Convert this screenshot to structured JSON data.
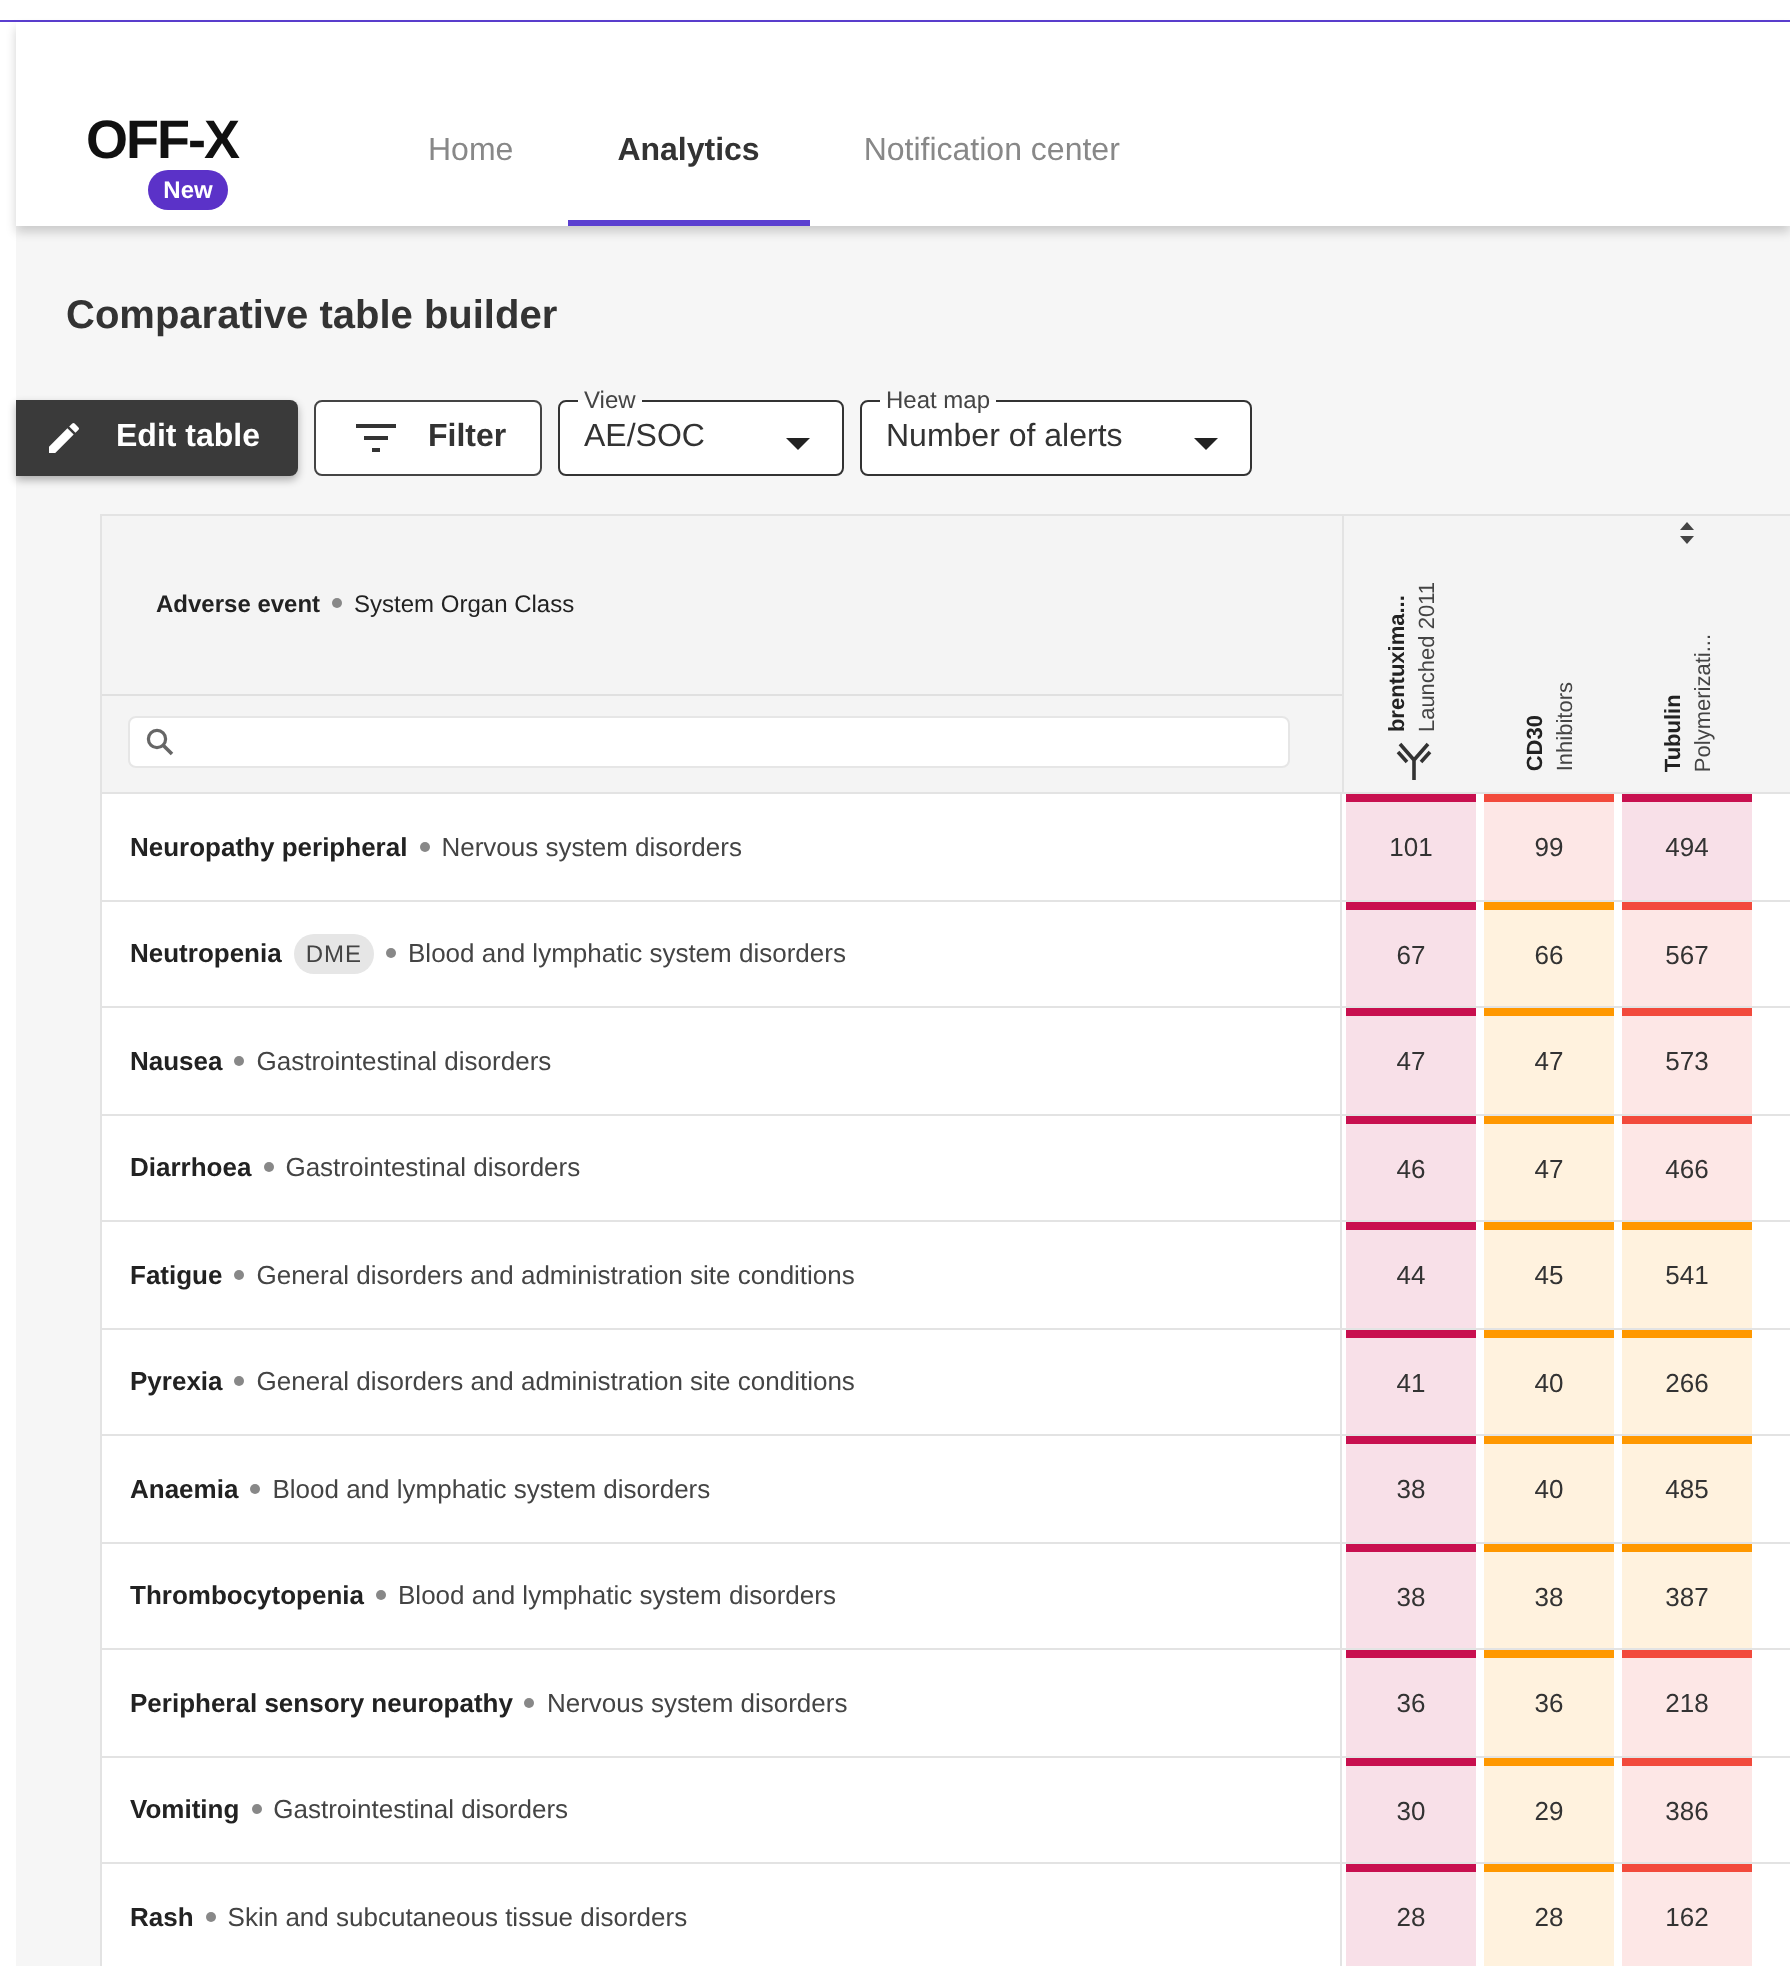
{
  "top_nav": {
    "logo": "OFF-X",
    "logo_badge": "New",
    "tabs": [
      {
        "label": "Home",
        "selected": false
      },
      {
        "label": "Analytics",
        "selected": true
      },
      {
        "label": "Notification center",
        "selected": false
      }
    ]
  },
  "page_title": "Comparative table builder",
  "toolbar": {
    "edit_button": "Edit table",
    "filter_button": "Filter",
    "view": {
      "label": "View",
      "value": "AE/SOC"
    },
    "heat_map": {
      "label": "Heat map",
      "value": "Number of alerts"
    }
  },
  "table": {
    "header": {
      "name_label": "Adverse event",
      "class_label": "System Organ Class"
    },
    "columns": [
      {
        "name": "brentuxima...",
        "sub": "Launched 2011",
        "kind": "drug",
        "sortable": false
      },
      {
        "name": "CD30",
        "sub": "Inhibitors",
        "kind": "class",
        "sortable": false
      },
      {
        "name": "Tubulin",
        "sub": "Polymerizati...",
        "kind": "class",
        "sortable": true
      }
    ],
    "rows": [
      {
        "event": "Neuropathy peripheral",
        "soc": "Nervous system disorders",
        "cells": [
          {
            "value": "101",
            "color": "#c8104f"
          },
          {
            "value": "99",
            "color": "#f24a3c"
          },
          {
            "value": "494",
            "color": "#c8104f"
          }
        ]
      },
      {
        "event": "Neutropenia",
        "tag": "DME",
        "soc": "Blood and lymphatic system disorders",
        "cells": [
          {
            "value": "67",
            "color": "#c8104f"
          },
          {
            "value": "66",
            "color": "#ff9800"
          },
          {
            "value": "567",
            "color": "#f24a3c"
          }
        ]
      },
      {
        "event": "Nausea",
        "soc": "Gastrointestinal disorders",
        "cells": [
          {
            "value": "47",
            "color": "#c8104f"
          },
          {
            "value": "47",
            "color": "#ff9800"
          },
          {
            "value": "573",
            "color": "#f24a3c"
          }
        ]
      },
      {
        "event": "Diarrhoea",
        "soc": "Gastrointestinal disorders",
        "cells": [
          {
            "value": "46",
            "color": "#c8104f"
          },
          {
            "value": "47",
            "color": "#ff9800"
          },
          {
            "value": "466",
            "color": "#f24a3c"
          }
        ]
      },
      {
        "event": "Fatigue",
        "soc": "General disorders and administration site conditions",
        "cells": [
          {
            "value": "44",
            "color": "#c8104f"
          },
          {
            "value": "45",
            "color": "#ff9800"
          },
          {
            "value": "541",
            "color": "#ff9800"
          }
        ]
      },
      {
        "event": "Pyrexia",
        "soc": "General disorders and administration site conditions",
        "cells": [
          {
            "value": "41",
            "color": "#c8104f"
          },
          {
            "value": "40",
            "color": "#ff9800"
          },
          {
            "value": "266",
            "color": "#ff9800"
          }
        ]
      },
      {
        "event": "Anaemia",
        "soc": "Blood and lymphatic system disorders",
        "cells": [
          {
            "value": "38",
            "color": "#c8104f"
          },
          {
            "value": "40",
            "color": "#ff9800"
          },
          {
            "value": "485",
            "color": "#ff9800"
          }
        ]
      },
      {
        "event": "Thrombocytopenia",
        "soc": "Blood and lymphatic system disorders",
        "cells": [
          {
            "value": "38",
            "color": "#c8104f"
          },
          {
            "value": "38",
            "color": "#ff9800"
          },
          {
            "value": "387",
            "color": "#ff9800"
          }
        ]
      },
      {
        "event": "Peripheral sensory neuropathy",
        "soc": "Nervous system disorders",
        "cells": [
          {
            "value": "36",
            "color": "#c8104f"
          },
          {
            "value": "36",
            "color": "#ff9800"
          },
          {
            "value": "218",
            "color": "#f24a3c"
          }
        ]
      },
      {
        "event": "Vomiting",
        "soc": "Gastrointestinal disorders",
        "cells": [
          {
            "value": "30",
            "color": "#c8104f"
          },
          {
            "value": "29",
            "color": "#ff9800"
          },
          {
            "value": "386",
            "color": "#f24a3c"
          }
        ]
      },
      {
        "event": "Rash",
        "soc": "Skin and subcutaneous tissue disorders",
        "cells": [
          {
            "value": "28",
            "color": "#c8104f"
          },
          {
            "value": "28",
            "color": "#ff9800"
          },
          {
            "value": "162",
            "color": "#f24a3c"
          }
        ]
      }
    ]
  }
}
